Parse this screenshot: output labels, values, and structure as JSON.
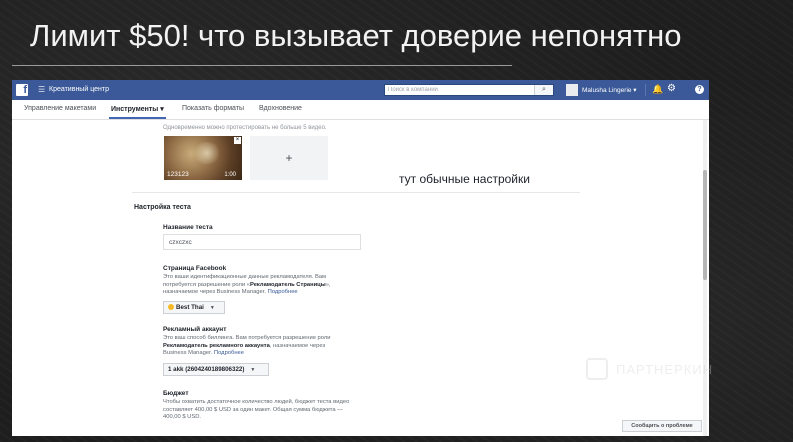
{
  "slide": {
    "title": "Лимит $50! что вызывает доверие непонятно"
  },
  "topbar": {
    "logo": "f",
    "app_title": "Креативный центр",
    "search_placeholder": "Поиск в компании",
    "account_name": "Malusha Lingerie ▾",
    "icons": [
      "hamburger-icon",
      "search-icon",
      "bell-icon",
      "gear-icon",
      "help-icon"
    ]
  },
  "nav": {
    "items": [
      {
        "label": "Управление макетами"
      },
      {
        "label": "Инструменты ▾"
      },
      {
        "label": "Показать форматы"
      },
      {
        "label": "Вдохновение"
      }
    ],
    "active_index": 1
  },
  "media": {
    "hint": "Одновременно можно протестировать не больше 5 видео.",
    "thumb_id": "123123",
    "thumb_time": "1:00",
    "add_label": "+"
  },
  "annotation": "тут обычные настройки",
  "test_settings": {
    "section_title": "Настройка теста",
    "name_label": "Название теста",
    "name_value": "czxczxc",
    "page": {
      "label": "Страница Facebook",
      "desc_1": "Это ваши идентификационные данные рекламодателя. Вам",
      "desc_2a": "потребуется разрешение роли «",
      "desc_2b": "Рекламодатель Страницы",
      "desc_2c": "»,",
      "desc_3a": "назначаемое через Business Manager. ",
      "desc_3b": "Подробнее",
      "selected": "Best Thai"
    },
    "ad_account": {
      "label": "Рекламный аккаунт",
      "desc_1": "Это ваш способ биллинга. Вам потребуется разрешение роли",
      "desc_2a": "Рекламодатель рекламного аккаунта",
      "desc_2b": ", назначаемое через",
      "desc_3a": "Business Manager. ",
      "desc_3b": "Подробнее",
      "selected": "1 akk (2604240189806322)"
    },
    "budget": {
      "label": "Бюджет",
      "desc_1": "Чтобы охватить достаточное количество людей, бюджет теста видео",
      "desc_2": "составляет 400,00 $ USD за один макет. Общая сумма бюджета —",
      "desc_3": "400,00 $ USD."
    }
  },
  "report_button": "Сообщить о проблеме",
  "watermark": {
    "text": "ПАРТНЕРКИН"
  }
}
